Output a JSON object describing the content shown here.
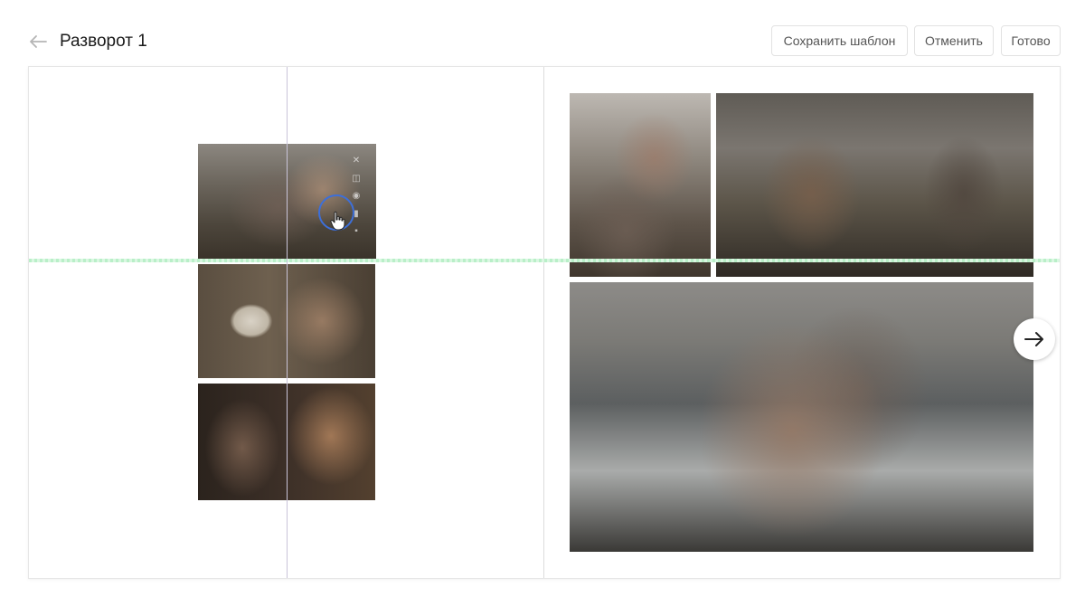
{
  "header": {
    "title": "Разворот 1",
    "back_icon": "arrow-left-icon",
    "buttons": {
      "save_template": "Сохранить шаблон",
      "cancel": "Отменить",
      "done": "Готово"
    }
  },
  "spread": {
    "left_page_photos": [
      "photo-1",
      "photo-2",
      "photo-3"
    ],
    "right_page_photos": [
      "photo-4",
      "photo-5",
      "photo-6"
    ],
    "selected_photo_tools": [
      "close-icon",
      "crop-icon",
      "eye-icon",
      "replace-icon",
      "delete-icon"
    ],
    "next_icon": "arrow-right-icon",
    "guide_color": "#b9efc8",
    "accent_color": "#3d6fd9"
  }
}
